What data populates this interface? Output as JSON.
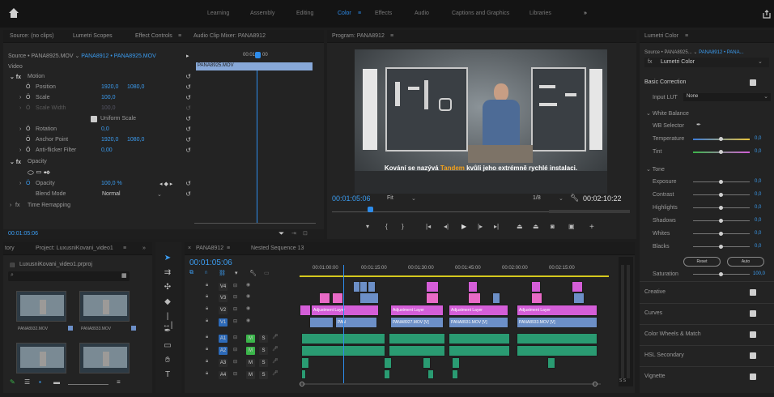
{
  "workspaces": {
    "home_icon": "home-icon",
    "items": [
      "Learning",
      "Assembly",
      "Editing",
      "Color",
      "Effects",
      "Audio",
      "Captions and Graphics",
      "Libraries"
    ],
    "active": "Color",
    "more": "»",
    "share_icon": "share-icon"
  },
  "source_panel": {
    "tabs": [
      "Source: (no clips)",
      "Lumetri Scopes",
      "Effect Controls",
      "Audio Clip Mixer: PANA8912"
    ],
    "active_tab": "Effect Controls",
    "tab_menu": "≡",
    "clip_selector": "Source • PANA8925.MOV",
    "sequence_selector": "PANA8912 • PANA8925.MOV",
    "section_video": "Video",
    "timecode_ruler": "00:01:",
    "timecode_ruler2": "00",
    "clip_bar_label": "PANA8925.MOV",
    "motion": "Motion",
    "position_label": "Position",
    "position_x": "1920,0",
    "position_y": "1080,0",
    "scale_label": "Scale",
    "scale_value": "100,0",
    "scale_width_label": "Scale Width",
    "scale_width_value": "100,0",
    "uniform_scale": "Uniform Scale",
    "rotation_label": "Rotation",
    "rotation_value": "0,0",
    "anchor_label": "Anchor Point",
    "anchor_x": "1920,0",
    "anchor_y": "1080,0",
    "antiflicker_label": "Anti-flicker Filter",
    "antiflicker_value": "0,00",
    "opacity_section": "Opacity",
    "opacity_label": "Opacity",
    "opacity_value": "100,0 %",
    "blend_label": "Blend Mode",
    "blend_value": "Normal",
    "time_remap": "Time Remapping",
    "current_time": "00:01:05:06"
  },
  "program_monitor": {
    "title": "Program: PANA8912",
    "menu": "≡",
    "caption_prefix": "Kování se nazývá",
    "caption_highlight": "Tandem",
    "caption_suffix": "kvůli jeho extrémně rychlé instalaci.",
    "timecode": "00:01:05:06",
    "fit": "Fit",
    "resolution": "1/8",
    "duration": "00:02:10:22"
  },
  "project_panel": {
    "tabs": [
      "tory",
      "Project: LuxusniKovani_video1"
    ],
    "menu": "≡",
    "more": "»",
    "file": "LuxusniKovani_video1.prproj",
    "search_placeholder": "",
    "thumbs": [
      "PANA8932.MOV",
      "PANA8933.MOV",
      "",
      ""
    ]
  },
  "timeline": {
    "tabs": [
      "PANA8912",
      "Nested Sequence 13"
    ],
    "close": "×",
    "menu": "≡",
    "timecode": "00:01:05:06",
    "ruler": [
      "00:01:00:00",
      "00:01:15:00",
      "00:01:30:00",
      "00:01:45:00",
      "00:02:00:00",
      "00:02:15:00"
    ],
    "tracks": [
      {
        "name": "V4",
        "kind": "v"
      },
      {
        "name": "V3",
        "kind": "v"
      },
      {
        "name": "V2",
        "kind": "v"
      },
      {
        "name": "V1",
        "kind": "v"
      },
      {
        "name": "A1",
        "kind": "a"
      },
      {
        "name": "A2",
        "kind": "a"
      },
      {
        "name": "A3",
        "kind": "a"
      },
      {
        "name": "A4",
        "kind": "a"
      }
    ],
    "adjustment_label": "Adjustment Layer",
    "v1_clips": [
      "PAN",
      "PANA8927.MOV [V]",
      "PANA8931.MOV [V]",
      "PANA8933.MOV [V]"
    ],
    "audio_buttons": [
      "M",
      "S"
    ],
    "meter_label": "S S"
  },
  "lumetri": {
    "title": "Lumetri Color",
    "menu": "≡",
    "source": "Source • PANA8925...",
    "sequence": "PANA8912 • PANA...",
    "effect_name": "Lumetri Color",
    "basic_correction": "Basic Correction",
    "input_lut_label": "Input LUT",
    "input_lut_value": "None",
    "white_balance": "White Balance",
    "wb_selector": "WB Selector",
    "temperature": "Temperature",
    "temperature_value": "0,0",
    "tint": "Tint",
    "tint_value": "0,0",
    "tone": "Tone",
    "exposure": "Exposure",
    "exposure_value": "0,0",
    "contrast": "Contrast",
    "contrast_value": "0,0",
    "highlights": "Highlights",
    "highlights_value": "0,0",
    "shadows": "Shadows",
    "shadows_value": "0,0",
    "whites": "Whites",
    "whites_value": "0,0",
    "blacks": "Blacks",
    "blacks_value": "0,0",
    "reset": "Reset",
    "auto": "Auto",
    "saturation": "Saturation",
    "saturation_value": "100,0",
    "sections": [
      "Creative",
      "Curves",
      "Color Wheels & Match",
      "HSL Secondary",
      "Vignette"
    ]
  },
  "colors": {
    "accent": "#2d8ceb",
    "audio": "#2a9b72",
    "video": "#6c8fc7",
    "adjustment": "#d45ed8"
  }
}
